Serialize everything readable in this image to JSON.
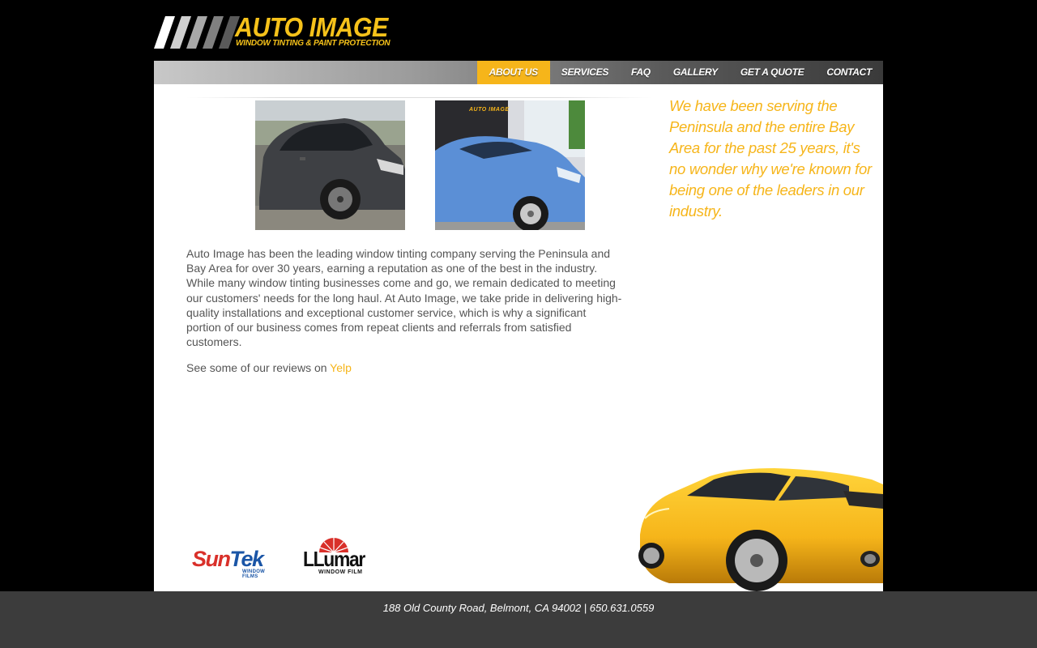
{
  "logo": {
    "brand": "AUTO IMAGE",
    "tagline": "WINDOW TINTING & PAINT PROTECTION"
  },
  "nav": {
    "items": [
      {
        "label": "ABOUT US",
        "active": true
      },
      {
        "label": "SERVICES",
        "active": false
      },
      {
        "label": "FAQ",
        "active": false
      },
      {
        "label": "GALLERY",
        "active": false
      },
      {
        "label": "GET A QUOTE",
        "active": false
      },
      {
        "label": "CONTACT",
        "active": false
      }
    ]
  },
  "main": {
    "quote": "We have been serving the Peninsula and the entire Bay Area for the past 25 years, it's no wonder why we're known for being one of the leaders in our industry.",
    "about": "Auto Image has been the leading window tinting company serving the Peninsula and Bay Area for over 30 years, earning a reputation as one of the best in the industry. While many window tinting businesses come and go, we remain dedicated to meeting our customers' needs for the long haul. At Auto Image, we take pride in delivering high-quality installations and exceptional customer service, which is why a significant portion of our business comes from repeat clients and referrals from satisfied customers.",
    "reviews_prefix": "See some of our reviews on ",
    "reviews_link": "Yelp",
    "photo_sign_text": "AUTO IMAGE"
  },
  "partners": {
    "suntek_sun": "Sun",
    "suntek_tek": "Tek",
    "suntek_sub": "WINDOW FILMS",
    "llumar": "LLumar",
    "llumar_sub": "WINDOW FILM"
  },
  "footer": {
    "address": "188 Old County Road, Belmont, CA 94002 | 650.631.0559"
  },
  "colors": {
    "accent": "#f6b51a",
    "background": "#000000",
    "footer": "#3c3c3c",
    "panel": "#ffffff"
  }
}
